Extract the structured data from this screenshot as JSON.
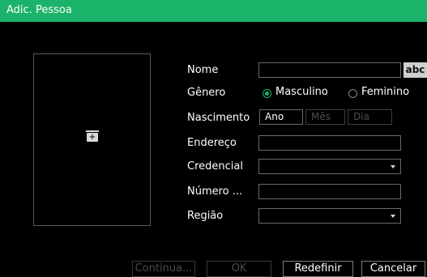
{
  "dialog": {
    "title": "Adic. Pessoa"
  },
  "form": {
    "name_label": "Nome",
    "abc_label": "abc",
    "gender_label": "Gênero",
    "gender_options": [
      "Masculino",
      "Feminino"
    ],
    "gender_selected": "Masculino",
    "birth_label": "Nascimento",
    "birth_year": "Ano",
    "birth_month": "Mês",
    "birth_day": "Dia",
    "address_label": "Endereço",
    "credential_label": "Credencial",
    "credential_value": "",
    "number_label": "Número ...",
    "region_label": "Região",
    "region_value": ""
  },
  "buttons": {
    "continue": "Continua...",
    "ok": "OK",
    "reset": "Redefinir",
    "cancel": "Cancelar"
  },
  "colors": {
    "accent": "#1bb36a",
    "background": "#000000"
  }
}
